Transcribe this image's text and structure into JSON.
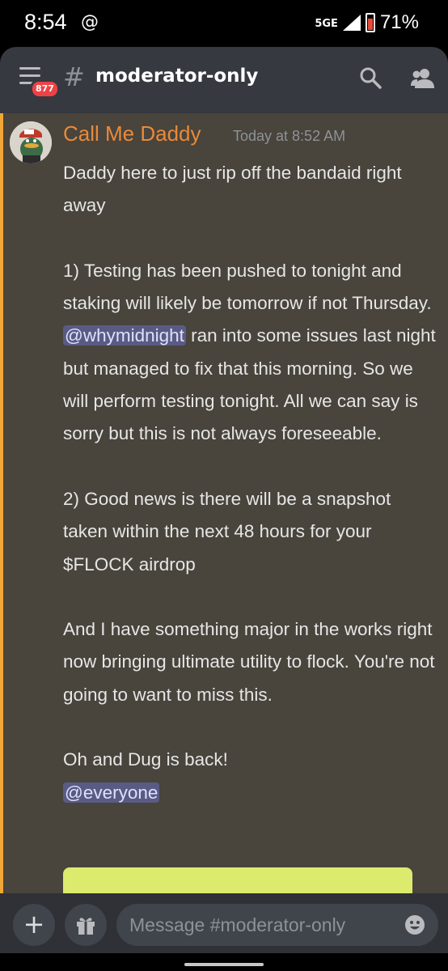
{
  "status_bar": {
    "time": "8:54",
    "at_symbol": "@",
    "network": "5GE",
    "battery_percent": "71%"
  },
  "header": {
    "notification_count": "877",
    "channel_name": "moderator-only"
  },
  "message": {
    "author": "Call Me Daddy",
    "timestamp": "Today at 8:52 AM",
    "p1": "Daddy here to just rip off the bandaid right away",
    "p2_before": "1) Testing has been pushed to tonight and staking will likely be tomorrow if not Thursday. ",
    "p2_mention": "@whymidnight",
    "p2_after": " ran into some issues last night but managed to fix that this morning. So we will perform testing tonight. All we can say is sorry but this is not always foreseeable.",
    "p3": "2) Good news is there will be a snapshot taken within the next 48 hours for your $FLOCK airdrop",
    "p4": "And I have something major in the works right now bringing ultimate utility to flock. You're not going to want to miss this.",
    "p5": "Oh and Dug is back!",
    "p6_mention": "@everyone"
  },
  "composer": {
    "placeholder": "Message #moderator-only",
    "plus_label": "+"
  },
  "colors": {
    "mention_highlight": "#f1a738",
    "author": "#e98a3a",
    "mention_bg": "#5a5b85",
    "embed_color": "#dcea6e"
  }
}
